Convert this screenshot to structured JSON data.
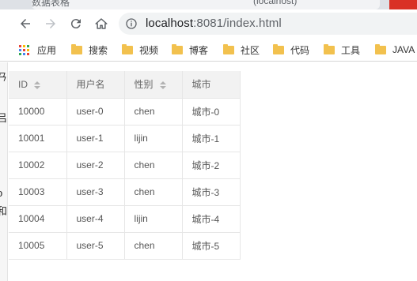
{
  "browser": {
    "tab_title_left": "数据表格",
    "tab_title_right": "(localhost)",
    "url_host": "localhost",
    "url_rest": ":8081/index.html",
    "accent_close": "#d93025"
  },
  "bookmarks": [
    {
      "label": "应用",
      "icon": "apps-grid-icon"
    },
    {
      "label": "搜索",
      "icon": "folder-icon"
    },
    {
      "label": "视频",
      "icon": "folder-icon"
    },
    {
      "label": "博客",
      "icon": "folder-icon"
    },
    {
      "label": "社区",
      "icon": "folder-icon"
    },
    {
      "label": "代码",
      "icon": "folder-icon"
    },
    {
      "label": "工具",
      "icon": "folder-icon"
    },
    {
      "label": "JAVA",
      "icon": "folder-icon"
    }
  ],
  "left_edge_glyphs": [
    "/A",
    "ㄢ",
    "吕",
    "o",
    "和"
  ],
  "table": {
    "headers": [
      "ID",
      "用户名",
      "性别",
      "城市"
    ],
    "sortable": [
      true,
      false,
      true,
      false
    ],
    "rows": [
      [
        "10000",
        "user-0",
        "chen",
        "城市-0"
      ],
      [
        "10001",
        "user-1",
        "lijin",
        "城市-1"
      ],
      [
        "10002",
        "user-2",
        "chen",
        "城市-2"
      ],
      [
        "10003",
        "user-3",
        "chen",
        "城市-3"
      ],
      [
        "10004",
        "user-4",
        "lijin",
        "城市-4"
      ],
      [
        "10005",
        "user-5",
        "chen",
        "城市-5"
      ]
    ]
  }
}
